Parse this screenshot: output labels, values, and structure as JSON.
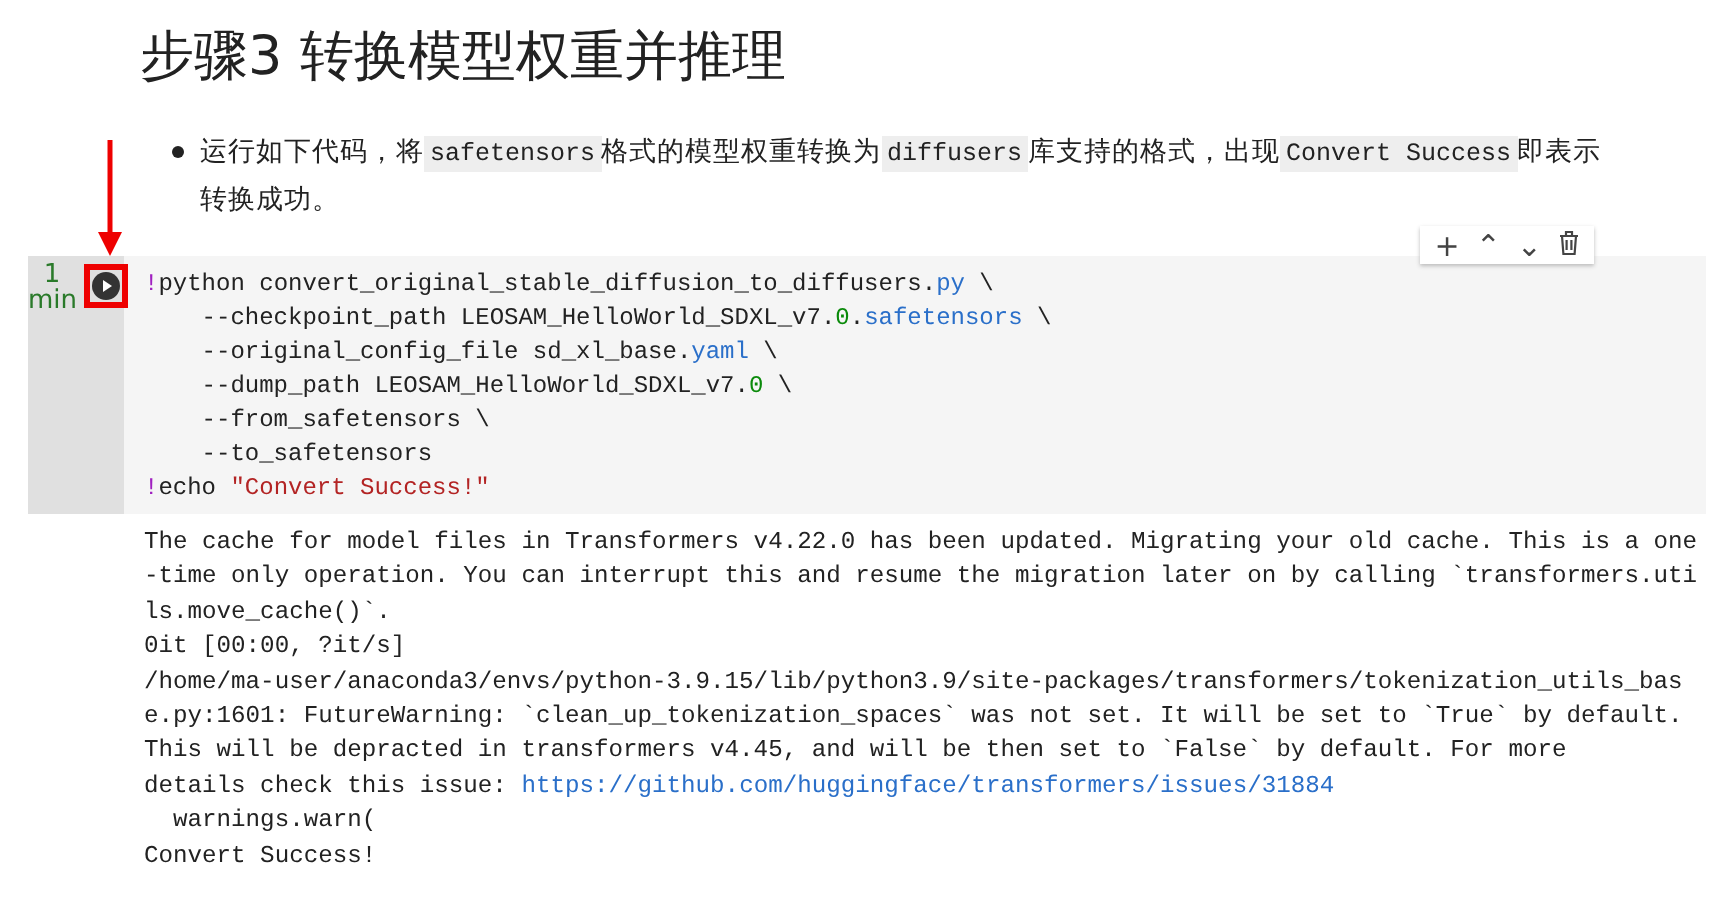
{
  "heading": "步骤3 转换模型权重并推理",
  "bullet": {
    "parts": [
      {
        "kind": "text",
        "text": "运行如下代码，将"
      },
      {
        "kind": "code",
        "text": "safetensors"
      },
      {
        "kind": "text",
        "text": "格式的模型权重转换为"
      },
      {
        "kind": "code",
        "text": "diffusers"
      },
      {
        "kind": "text",
        "text": "库支持的格式，出现"
      },
      {
        "kind": "code",
        "text": "Convert Success"
      },
      {
        "kind": "text",
        "text": "即表示转换成功。"
      }
    ]
  },
  "cell": {
    "exec_count": [
      "1",
      "min"
    ],
    "toolbar": [
      "+",
      "⌃",
      "⌄"
    ],
    "code": [
      [
        {
          "kind": "magic",
          "text": "!"
        },
        {
          "kind": "plain",
          "text": "python convert_original_stable_diffusion_to_diffusers."
        },
        {
          "kind": "attr",
          "text": "py"
        },
        {
          "kind": "plain",
          "text": " \\"
        }
      ],
      [
        {
          "kind": "plain",
          "text": "    --checkpoint_path LEOSAM_HelloWorld_SDXL_v7."
        },
        {
          "kind": "number",
          "text": "0"
        },
        {
          "kind": "plain",
          "text": "."
        },
        {
          "kind": "attr",
          "text": "safetensors"
        },
        {
          "kind": "plain",
          "text": " \\"
        }
      ],
      [
        {
          "kind": "plain",
          "text": "    --original_config_file sd_xl_base."
        },
        {
          "kind": "attr",
          "text": "yaml"
        },
        {
          "kind": "plain",
          "text": " \\"
        }
      ],
      [
        {
          "kind": "plain",
          "text": "    --dump_path LEOSAM_HelloWorld_SDXL_v7."
        },
        {
          "kind": "number",
          "text": "0"
        },
        {
          "kind": "plain",
          "text": " \\"
        }
      ],
      [
        {
          "kind": "plain",
          "text": "    --from_safetensors \\"
        }
      ],
      [
        {
          "kind": "plain",
          "text": "    --to_safetensors"
        }
      ],
      [
        {
          "kind": "magic",
          "text": "!"
        },
        {
          "kind": "plain",
          "text": "echo "
        },
        {
          "kind": "string",
          "text": "\"Convert Success!\""
        }
      ]
    ],
    "output": [
      [
        {
          "kind": "plain",
          "text": "The cache for model files in Transformers v4.22.0 has been updated. Migrating your old cache. This is a one"
        }
      ],
      [
        {
          "kind": "plain",
          "text": "-time only operation. You can interrupt this and resume the migration later on by calling `transformers.uti"
        }
      ],
      [
        {
          "kind": "plain",
          "text": "ls.move_cache()`."
        }
      ],
      [
        {
          "kind": "plain",
          "text": "0it [00:00, ?it/s]"
        }
      ],
      [
        {
          "kind": "plain",
          "text": "/home/ma-user/anaconda3/envs/python-3.9.15/lib/python3.9/site-packages/transformers/tokenization_utils_bas"
        }
      ],
      [
        {
          "kind": "plain",
          "text": "e.py:1601: FutureWarning: `clean_up_tokenization_spaces` was not set. It will be set to `True` by default."
        }
      ],
      [
        {
          "kind": "plain",
          "text": "This will be depracted in transformers v4.45, and will be then set to `False` by default. For more"
        }
      ],
      [
        {
          "kind": "plain",
          "text": "details check this issue: "
        },
        {
          "kind": "link",
          "text": "https://github.com/huggingface/transformers/issues/31884"
        }
      ],
      [
        {
          "kind": "plain",
          "text": "  warnings.warn("
        }
      ],
      [
        {
          "kind": "plain",
          "text": "Convert Success!"
        }
      ]
    ]
  }
}
